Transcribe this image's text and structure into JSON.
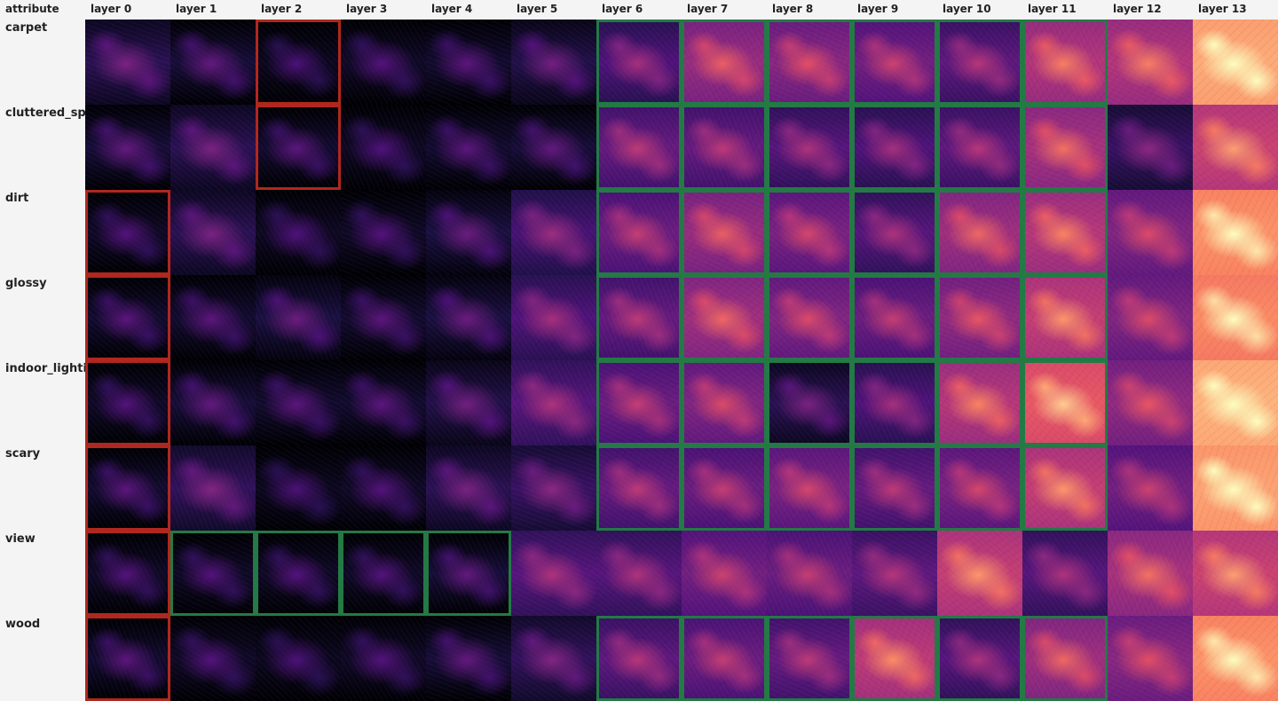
{
  "header": {
    "attribute_label": "attribute",
    "layers": [
      "layer 0",
      "layer 1",
      "layer 2",
      "layer 3",
      "layer 4",
      "layer 5",
      "layer 6",
      "layer 7",
      "layer 8",
      "layer 9",
      "layer 10",
      "layer 11",
      "layer 12",
      "layer 13"
    ]
  },
  "rows": [
    {
      "attribute": "carpet",
      "intensity": [
        0.18,
        0.12,
        0.06,
        0.08,
        0.1,
        0.16,
        0.28,
        0.48,
        0.44,
        0.38,
        0.32,
        0.55,
        0.55,
        0.92
      ],
      "highlight": [
        "none",
        "none",
        "red",
        "none",
        "none",
        "none",
        "green",
        "green",
        "green",
        "green",
        "green",
        "green",
        "none",
        "none"
      ]
    },
    {
      "attribute": "cluttered_space",
      "intensity": [
        0.12,
        0.18,
        0.1,
        0.07,
        0.1,
        0.12,
        0.34,
        0.34,
        0.3,
        0.28,
        0.32,
        0.52,
        0.22,
        0.62
      ],
      "highlight": [
        "none",
        "none",
        "red",
        "none",
        "none",
        "none",
        "green",
        "green",
        "green",
        "green",
        "green",
        "green",
        "none",
        "none"
      ]
    },
    {
      "attribute": "dirt",
      "intensity": [
        0.08,
        0.18,
        0.07,
        0.08,
        0.14,
        0.26,
        0.36,
        0.48,
        0.4,
        0.3,
        0.5,
        0.56,
        0.42,
        0.86
      ],
      "highlight": [
        "red",
        "none",
        "none",
        "none",
        "none",
        "none",
        "green",
        "green",
        "green",
        "green",
        "green",
        "green",
        "none",
        "none"
      ]
    },
    {
      "attribute": "glossy",
      "intensity": [
        0.1,
        0.1,
        0.14,
        0.1,
        0.14,
        0.28,
        0.34,
        0.5,
        0.42,
        0.36,
        0.46,
        0.6,
        0.42,
        0.84
      ],
      "highlight": [
        "red",
        "none",
        "none",
        "none",
        "none",
        "none",
        "green",
        "green",
        "green",
        "green",
        "green",
        "green",
        "none",
        "none"
      ]
    },
    {
      "attribute": "indoor_lighting",
      "intensity": [
        0.08,
        0.12,
        0.1,
        0.1,
        0.16,
        0.3,
        0.36,
        0.42,
        0.18,
        0.28,
        0.56,
        0.72,
        0.46,
        0.94
      ],
      "highlight": [
        "red",
        "none",
        "none",
        "none",
        "none",
        "none",
        "green",
        "green",
        "green",
        "green",
        "green",
        "green",
        "none",
        "none"
      ]
    },
    {
      "attribute": "scary",
      "intensity": [
        0.1,
        0.2,
        0.06,
        0.08,
        0.18,
        0.22,
        0.34,
        0.36,
        0.4,
        0.34,
        0.4,
        0.6,
        0.38,
        0.9
      ],
      "highlight": [
        "red",
        "none",
        "none",
        "none",
        "none",
        "none",
        "green",
        "green",
        "green",
        "green",
        "green",
        "green",
        "none",
        "none"
      ]
    },
    {
      "attribute": "view",
      "intensity": [
        0.08,
        0.08,
        0.08,
        0.08,
        0.12,
        0.3,
        0.3,
        0.38,
        0.36,
        0.32,
        0.6,
        0.3,
        0.52,
        0.62
      ],
      "highlight": [
        "red",
        "green",
        "green",
        "green",
        "green",
        "none",
        "none",
        "none",
        "none",
        "none",
        "none",
        "none",
        "none",
        "none"
      ]
    },
    {
      "attribute": "wood",
      "intensity": [
        0.1,
        0.08,
        0.06,
        0.08,
        0.12,
        0.2,
        0.32,
        0.36,
        0.34,
        0.58,
        0.3,
        0.5,
        0.44,
        0.86
      ],
      "highlight": [
        "red",
        "none",
        "none",
        "none",
        "none",
        "none",
        "green",
        "green",
        "green",
        "green",
        "green",
        "green",
        "none",
        "none"
      ]
    }
  ],
  "colors": {
    "background": "#f4f4f4",
    "highlight_red": "#b0271f",
    "highlight_green": "#237a45",
    "colormap": "magma"
  }
}
